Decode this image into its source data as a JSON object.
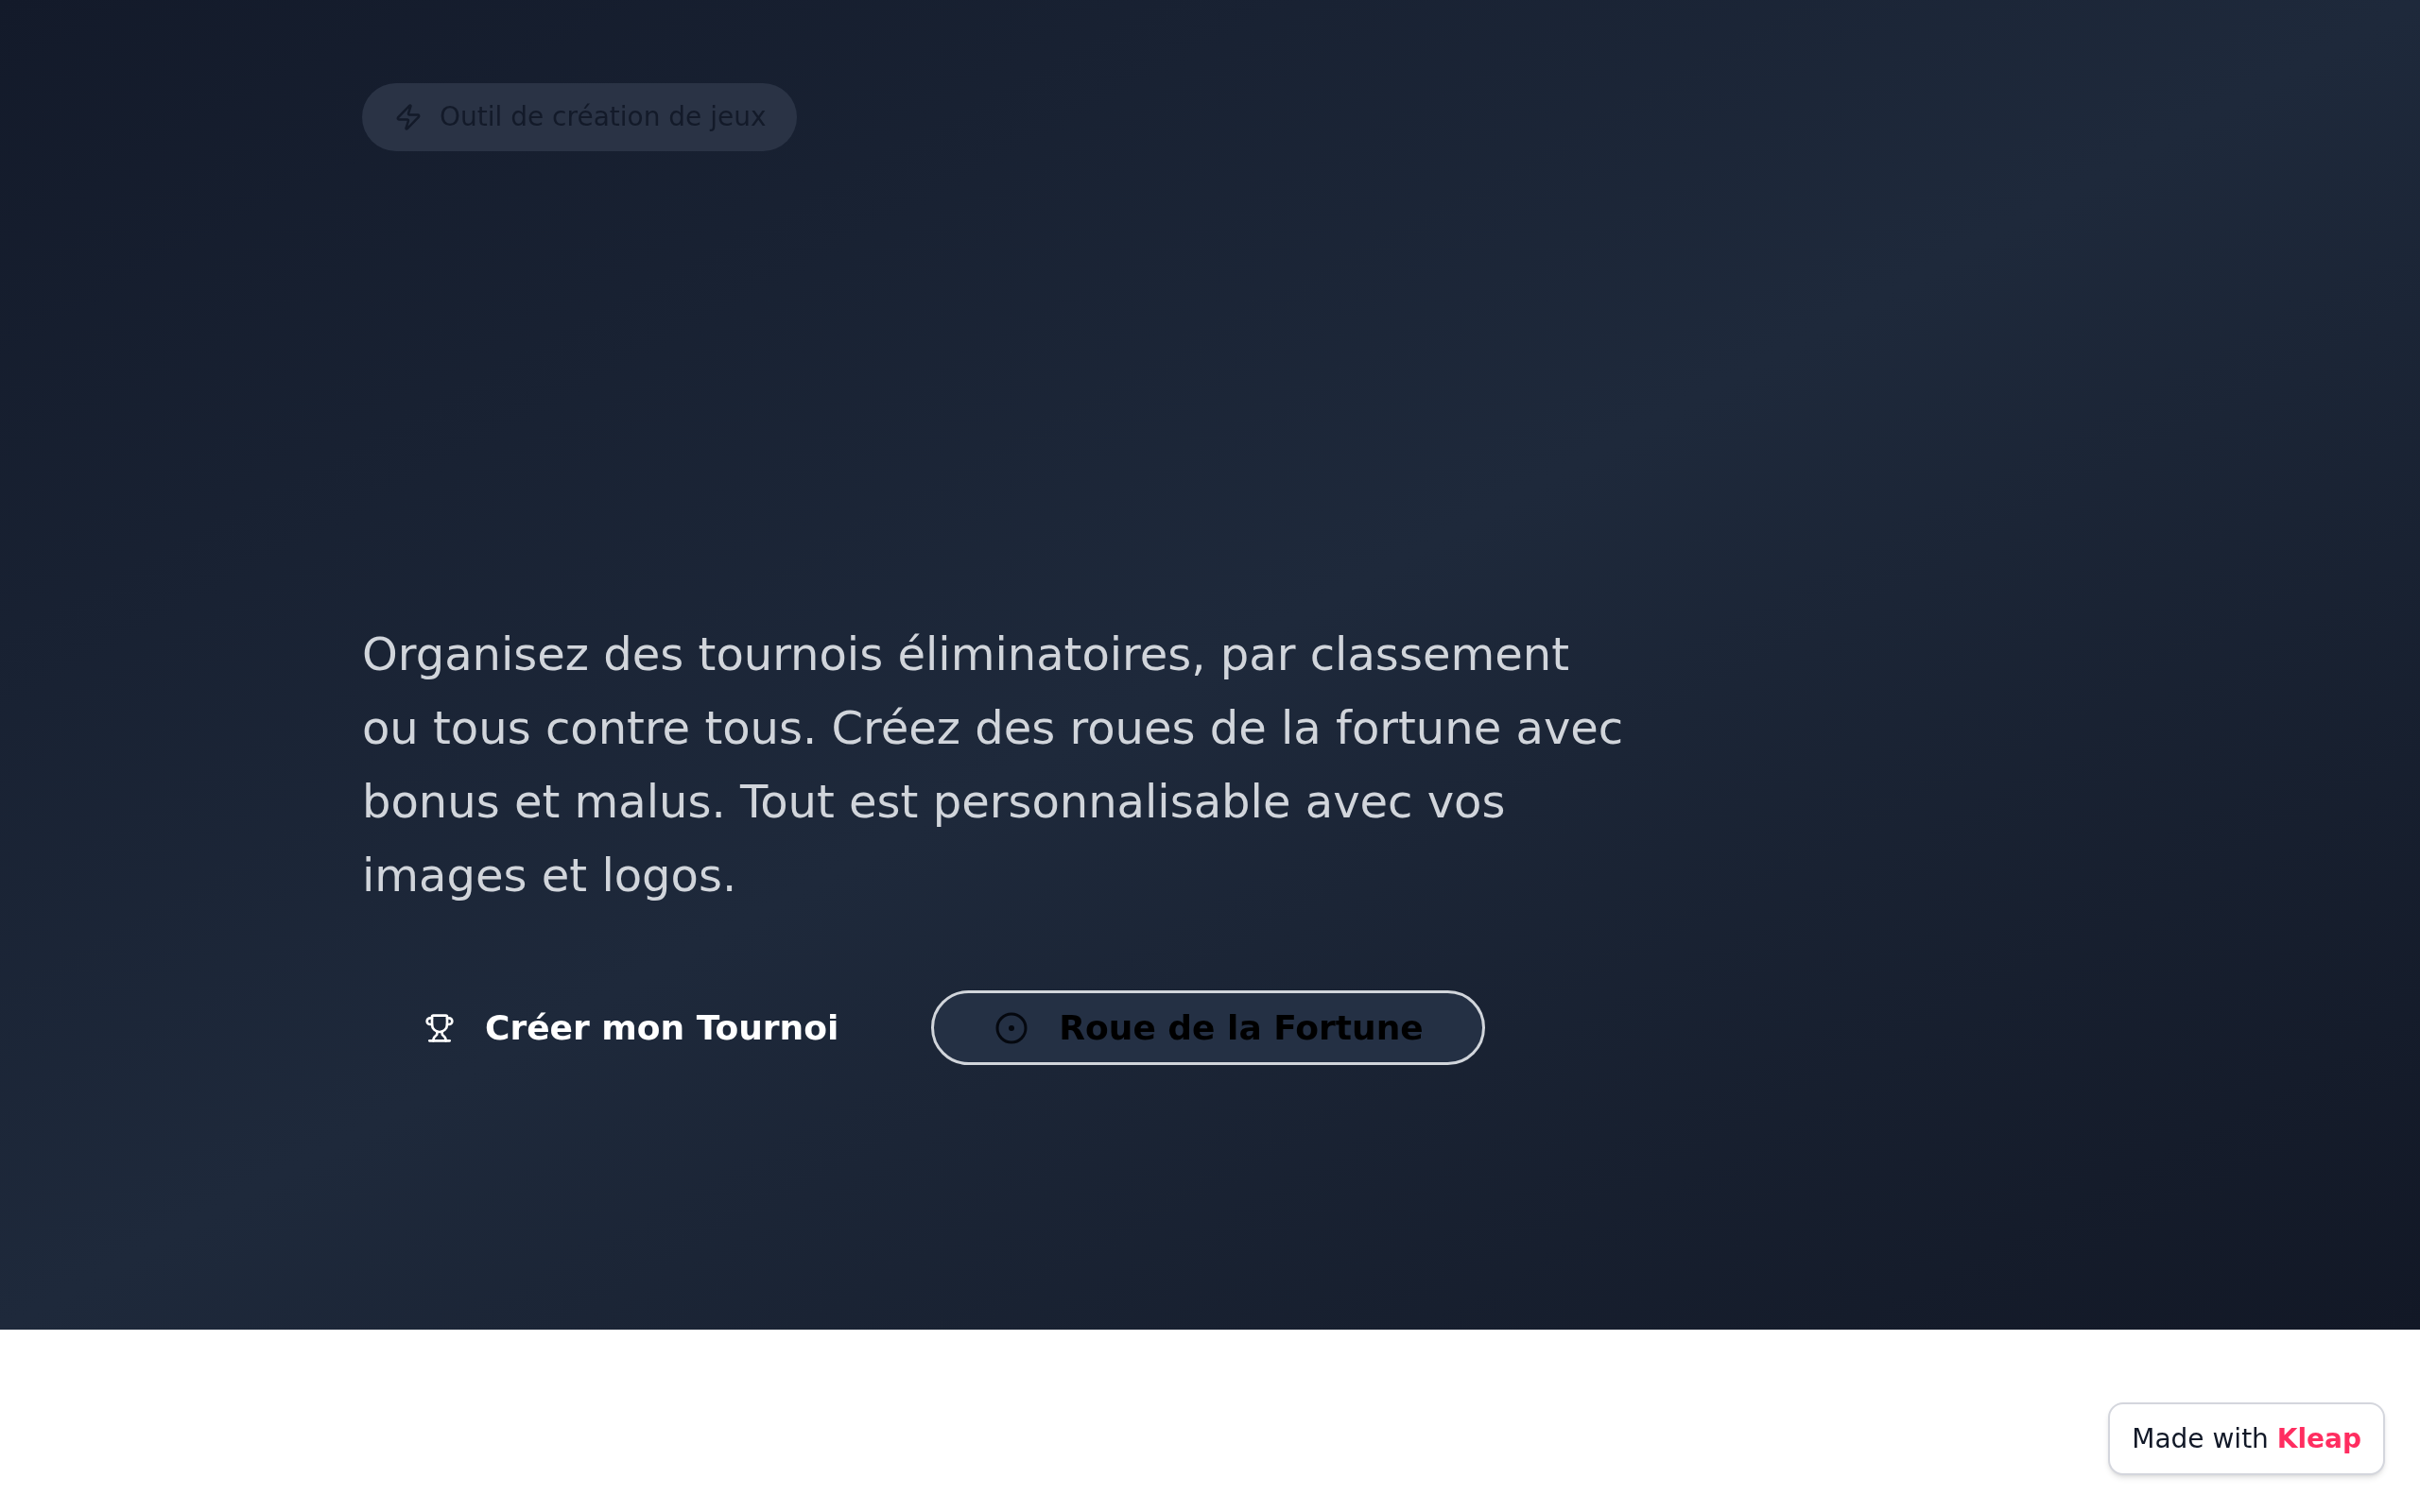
{
  "badge": {
    "label": "Outil de création de jeux"
  },
  "description": "Organisez des tournois éliminatoires, par classement ou tous contre tous. Créez des roues de la fortune avec bonus et malus. Tout est personnalisable avec vos images et logos.",
  "buttons": [
    {
      "kind": "primary",
      "label": "Créer mon Tournoi"
    },
    {
      "kind": "outline",
      "label": "Roue de la Fortune"
    }
  ],
  "made_with": "Made with **Kleap**"
}
